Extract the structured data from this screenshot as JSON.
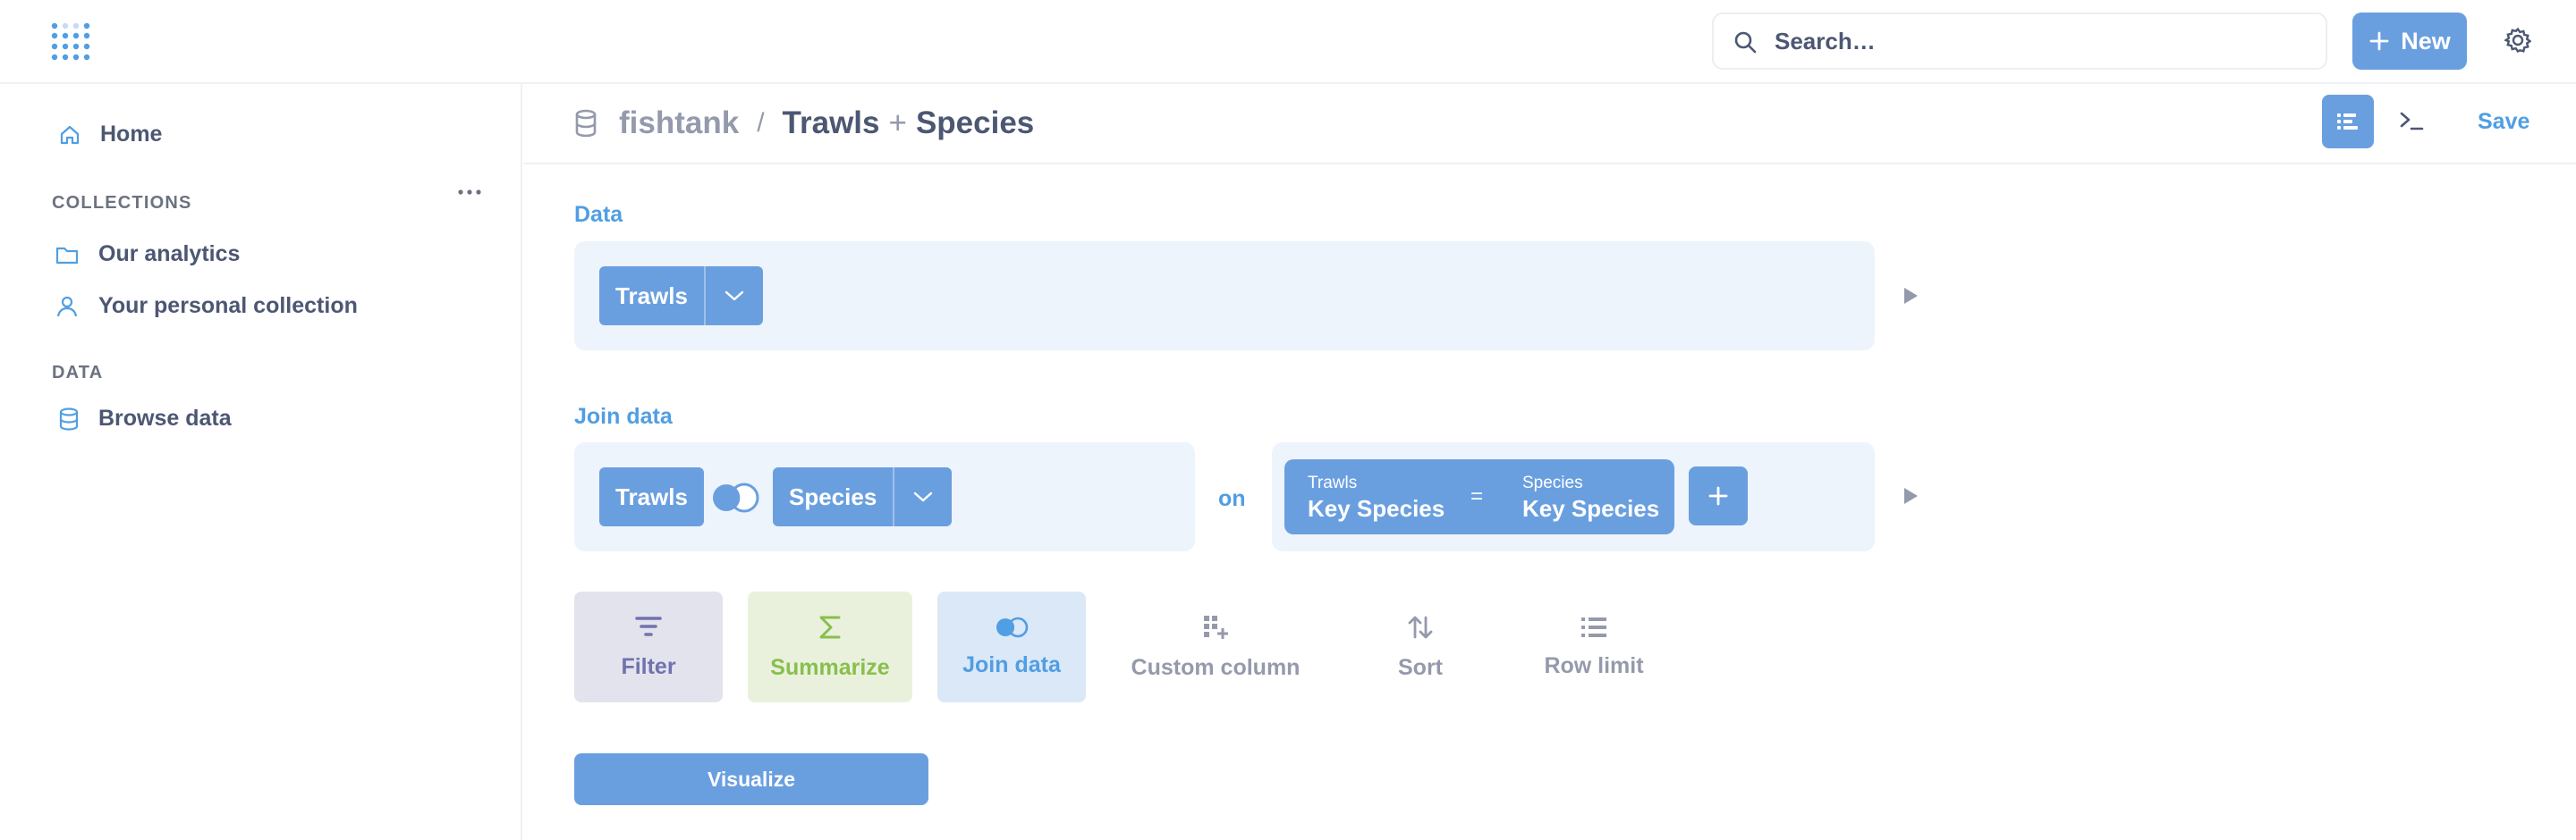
{
  "search": {
    "placeholder": "Search…"
  },
  "topbar": {
    "new_label": "New"
  },
  "sidebar": {
    "home_label": "Home",
    "collections_heading": "COLLECTIONS",
    "collections": [
      {
        "label": "Our analytics",
        "icon": "folder-icon"
      },
      {
        "label": "Your personal collection",
        "icon": "person-icon"
      }
    ],
    "data_heading": "DATA",
    "browse_label": "Browse data"
  },
  "header": {
    "database": "fishtank",
    "separator": "/",
    "table": "Trawls",
    "join_symbol": "+",
    "joined_table": "Species",
    "save_label": "Save"
  },
  "notebook": {
    "data_label": "Data",
    "data_table": "Trawls",
    "join_label": "Join data",
    "join_left_table": "Trawls",
    "join_right_table": "Species",
    "on_label": "on",
    "condition": {
      "left_table": "Trawls",
      "left_field": "Key Species",
      "operator": "=",
      "right_table": "Species",
      "right_field": "Key Species"
    },
    "actions": [
      {
        "label": "Filter",
        "icon": "filter-icon"
      },
      {
        "label": "Summarize",
        "icon": "sigma-icon"
      },
      {
        "label": "Join data",
        "icon": "join-icon"
      },
      {
        "label": "Custom column",
        "icon": "custom-column-icon"
      },
      {
        "label": "Sort",
        "icon": "sort-icon"
      },
      {
        "label": "Row limit",
        "icon": "list-icon"
      }
    ],
    "visualize_label": "Visualize"
  },
  "colors": {
    "brand": "#509ee3",
    "pill": "#6a9fdf",
    "panel": "#edf4fc",
    "filter_bg": "#e3e3ee",
    "filter_fg": "#7172ad",
    "summarize_bg": "#e9f1dc",
    "summarize_fg": "#88bf4d",
    "join_bg": "#dbe8f7"
  }
}
